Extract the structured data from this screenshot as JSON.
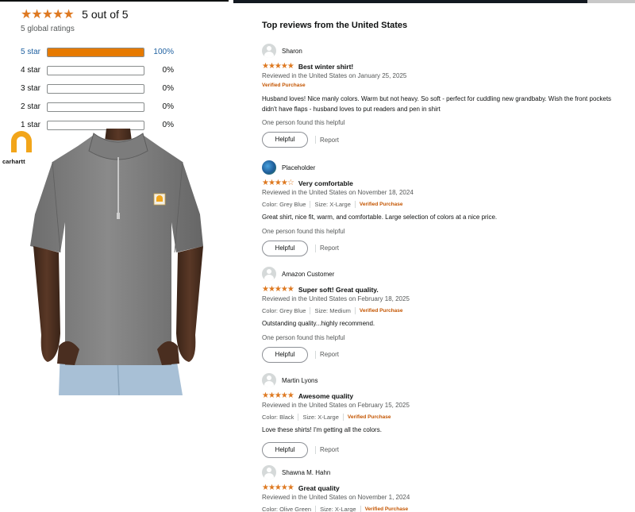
{
  "summary": {
    "stars": "★★★★★",
    "out_of": "5 out of 5",
    "global_ratings": "5 global ratings",
    "histogram": [
      {
        "label": "5 star",
        "percent": 100,
        "pct_text": "100%"
      },
      {
        "label": "4 star",
        "percent": 0,
        "pct_text": "0%"
      },
      {
        "label": "3 star",
        "percent": 0,
        "pct_text": "0%"
      },
      {
        "label": "2 star",
        "percent": 0,
        "pct_text": "0%"
      },
      {
        "label": "1 star",
        "percent": 0,
        "pct_text": "0%"
      }
    ]
  },
  "brand": {
    "logo_text": "carhartt"
  },
  "reviews_header": "Top reviews from the United States",
  "reviews": [
    {
      "name": "Sharon",
      "avatar": "default-avatar-icon",
      "stars": "★★★★★",
      "rating": 5,
      "title": "Best winter shirt!",
      "meta": "Reviewed in the United States on January 25, 2025",
      "color": "",
      "size": "",
      "verified": "Verified Purchase",
      "body": "Husband loves! Nice manly colors. Warm but not heavy. So soft - perfect for cuddling new grandbaby. Wish the front pockets didn't have flaps - husband loves to put readers and pen in shirt",
      "helpful_count": "One person found this helpful",
      "helpful_label": "Helpful",
      "report_label": "Report"
    },
    {
      "name": "Placeholder",
      "avatar": "photo-avatar-icon",
      "stars": "★★★★☆",
      "rating": 4,
      "title": "Very comfortable",
      "meta": "Reviewed in the United States on November 18, 2024",
      "color": "Color: Grey Blue",
      "size": "Size: X-Large",
      "verified": "Verified Purchase",
      "body": "Great shirt, nice fit, warm, and comfortable. Large selection of colors at a nice price.",
      "helpful_count": "One person found this helpful",
      "helpful_label": "Helpful",
      "report_label": "Report"
    },
    {
      "name": "Amazon Customer",
      "avatar": "default-avatar-icon",
      "stars": "★★★★★",
      "rating": 5,
      "title": "Super soft! Great quality.",
      "meta": "Reviewed in the United States on February 18, 2025",
      "color": "Color: Grey Blue",
      "size": "Size: Medium",
      "verified": "Verified Purchase",
      "body": "Outstanding quality...highly recommend.",
      "helpful_count": "One person found this helpful",
      "helpful_label": "Helpful",
      "report_label": "Report"
    },
    {
      "name": "Martin Lyons",
      "avatar": "default-avatar-icon",
      "stars": "★★★★★",
      "rating": 5,
      "title": "Awesome quality",
      "meta": "Reviewed in the United States on February 15, 2025",
      "color": "Color: Black",
      "size": "Size: X-Large",
      "verified": "Verified Purchase",
      "body": "Love these shirts! I'm getting all the colors.",
      "helpful_count": "",
      "helpful_label": "Helpful",
      "report_label": "Report"
    },
    {
      "name": "Shawna M. Hahn",
      "avatar": "default-avatar-icon",
      "stars": "★★★★★",
      "rating": 5,
      "title": "Great quality",
      "meta": "Reviewed in the United States on November 1, 2024",
      "color": "Color: Olive Green",
      "size": "Size: X-Large",
      "verified": "Verified Purchase",
      "body": "",
      "helpful_count": "",
      "helpful_label": "",
      "report_label": ""
    }
  ],
  "colors": {
    "star": "#de7921",
    "bar_fill": "#e67a00",
    "verified": "#c45500",
    "link": "#2162a1"
  }
}
